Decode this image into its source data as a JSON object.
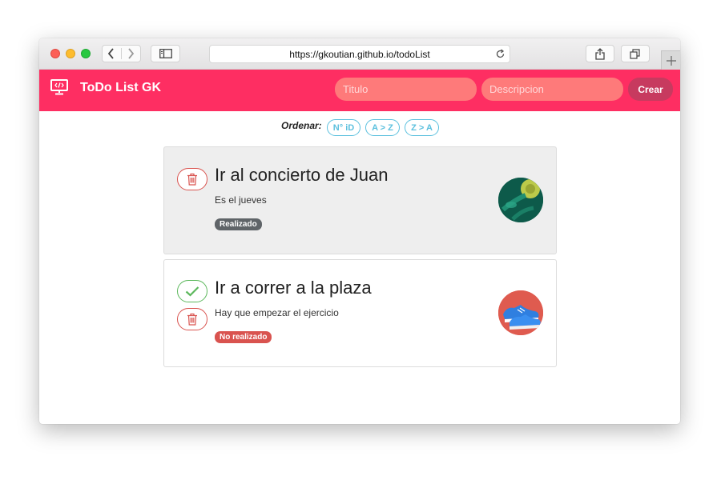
{
  "browser": {
    "url": "https://gkoutian.github.io/todoList"
  },
  "navbar": {
    "brand": "ToDo List GK",
    "brand_icon": "monitor-code-icon",
    "titulo_placeholder": "Titulo",
    "descripcion_placeholder": "Descripcion",
    "crear_label": "Crear",
    "color": "#fe2e62"
  },
  "sort": {
    "label": "Ordenar:",
    "options": [
      "N° iD",
      "A > Z",
      "Z > A"
    ]
  },
  "todos": [
    {
      "title": "Ir al concierto de Juan",
      "description": "Es el jueves",
      "status": "Realizado",
      "image_icon": "concert-avatar",
      "actions": [
        "trash-icon"
      ]
    },
    {
      "title": "Ir a correr a la plaza",
      "description": "Hay que empezar el ejercicio",
      "status": "No realizado",
      "image_icon": "sneakers-avatar",
      "actions": [
        "check-icon",
        "trash-icon"
      ]
    }
  ]
}
